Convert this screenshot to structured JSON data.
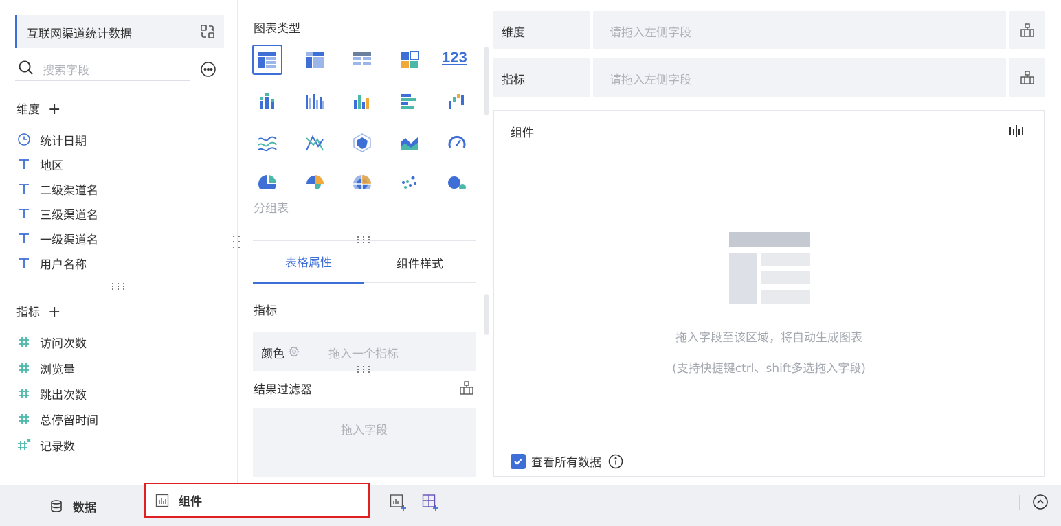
{
  "data_panel": {
    "dataset_title": "互联网渠道统计数据",
    "search_placeholder": "搜索字段",
    "dimension_title": "维度",
    "dimensions": [
      {
        "label": "统计日期",
        "icon": "clock-icon"
      },
      {
        "label": "地区",
        "icon": "text-type-icon"
      },
      {
        "label": "二级渠道名",
        "icon": "text-type-icon"
      },
      {
        "label": "三级渠道名",
        "icon": "text-type-icon"
      },
      {
        "label": "一级渠道名",
        "icon": "text-type-icon"
      },
      {
        "label": "用户名称",
        "icon": "text-type-icon"
      }
    ],
    "metric_title": "指标",
    "metrics": [
      {
        "label": "访问次数",
        "icon": "number-type-icon"
      },
      {
        "label": "浏览量",
        "icon": "number-type-icon"
      },
      {
        "label": "跳出次数",
        "icon": "number-type-icon"
      },
      {
        "label": "总停留时间",
        "icon": "number-type-icon"
      },
      {
        "label": "记录数",
        "icon": "record-count-icon"
      }
    ]
  },
  "chart_type_panel": {
    "title": "图表类型",
    "number_tile_text": "123",
    "selected_hint": "分组表",
    "tabs": [
      "表格属性",
      "组件样式"
    ],
    "active_tab": "表格属性",
    "property_title": "指标",
    "color_label": "颜色",
    "color_placeholder": "拖入一个指标",
    "filter_title": "结果过滤器",
    "filter_placeholder": "拖入字段"
  },
  "config_panel": {
    "dimension_label": "维度",
    "dimension_placeholder": "请拖入左侧字段",
    "metric_label": "指标",
    "metric_placeholder": "请拖入左侧字段",
    "component_title": "组件",
    "empty_hint": "拖入字段至该区域，将自动生成图表",
    "empty_hint_sub": "(支持快捷键ctrl、shift多选拖入字段)",
    "view_all_label": "查看所有数据",
    "view_all_checked": true
  },
  "bottom_bar": {
    "data_tab": "数据",
    "component_tab": "组件"
  },
  "colors": {
    "accent": "#3d6fd6",
    "teal": "#4bb8a9",
    "highlight_border": "#e02020",
    "panel_bg": "#f2f3f6"
  }
}
